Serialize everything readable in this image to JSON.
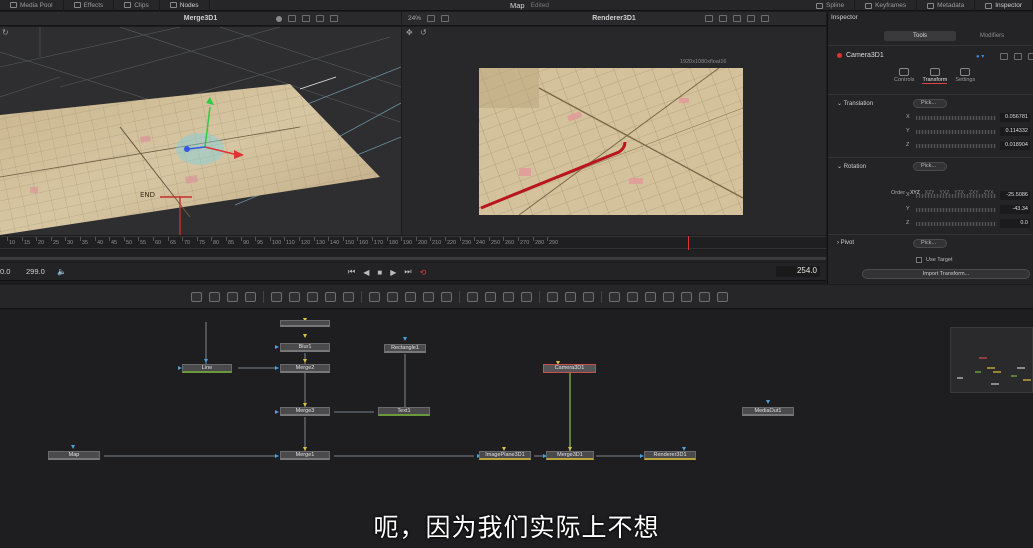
{
  "app": {
    "project_title": "Map",
    "project_status": "Edited"
  },
  "topbar": {
    "left_items": [
      {
        "label": "Media Pool",
        "icon": "media-pool-icon"
      },
      {
        "label": "Effects",
        "icon": "effects-icon"
      },
      {
        "label": "Clips",
        "icon": "clips-icon"
      },
      {
        "label": "Nodes",
        "icon": "nodes-icon"
      }
    ],
    "right_items": [
      {
        "label": "Spline",
        "icon": "spline-icon"
      },
      {
        "label": "Keyframes",
        "icon": "keyframes-icon"
      },
      {
        "label": "Metadata",
        "icon": "metadata-icon"
      },
      {
        "label": "Inspector",
        "icon": "inspector-icon"
      }
    ]
  },
  "viewer_left": {
    "title": "Merge3D1",
    "scene_text": "END"
  },
  "viewer_right": {
    "title": "Renderer3D1",
    "zoom": "24%",
    "resolution": "1920x1080xfloat16"
  },
  "ruler": {
    "ticks": [
      "10",
      "15",
      "20",
      "25",
      "30",
      "35",
      "40",
      "45",
      "50",
      "55",
      "60",
      "65",
      "70",
      "75",
      "80",
      "85",
      "90",
      "95",
      "100",
      "110",
      "120",
      "130",
      "140",
      "150",
      "160",
      "170",
      "180",
      "190",
      "200",
      "210",
      "220",
      "230",
      "240",
      "250",
      "260",
      "270",
      "280",
      "290"
    ]
  },
  "transport": {
    "start_time": "0.0",
    "end_time": "299.0",
    "current_time": "254.0"
  },
  "nodes": [
    {
      "id": "blur",
      "label": "Blur1"
    },
    {
      "id": "rectangle",
      "label": "Rectangle1"
    },
    {
      "id": "line",
      "label": "Line"
    },
    {
      "id": "merge2",
      "label": "Merge2"
    },
    {
      "id": "camera",
      "label": "Camera3D1"
    },
    {
      "id": "merge3",
      "label": "Merge3"
    },
    {
      "id": "text",
      "label": "Text1"
    },
    {
      "id": "mediaout",
      "label": "MediaOut1"
    },
    {
      "id": "map",
      "label": "Map"
    },
    {
      "id": "merge1",
      "label": "Merge1"
    },
    {
      "id": "imageplane",
      "label": "ImagePlane3D1"
    },
    {
      "id": "merge3d",
      "label": "Merge3D1"
    },
    {
      "id": "renderer",
      "label": "Renderer3D1"
    }
  ],
  "inspector": {
    "title": "Inspector",
    "tabs": [
      "Tools",
      "Modifiers"
    ],
    "node_name": "Camera3D1",
    "subtabs": [
      "Controls",
      "Transform",
      "Settings"
    ],
    "translation": {
      "label": "Translation",
      "pick": "Pick...",
      "x": "0.056781",
      "y": "0.114332",
      "z": "0.018904"
    },
    "rotation": {
      "label": "Rotation",
      "pick": "Pick...",
      "order_label": "Order",
      "orders": [
        "XYZ",
        "XZY",
        "YXZ",
        "YZX",
        "ZXY",
        "ZYX"
      ],
      "x": "-25.5086",
      "y": "-43.34",
      "z": "0.0"
    },
    "pivot": {
      "label": "Pivot",
      "pick": "Pick..."
    },
    "use_target": "Use Target",
    "import_transform": "Import Transform..."
  },
  "subtitle": "呃，因为我们实际上不想"
}
